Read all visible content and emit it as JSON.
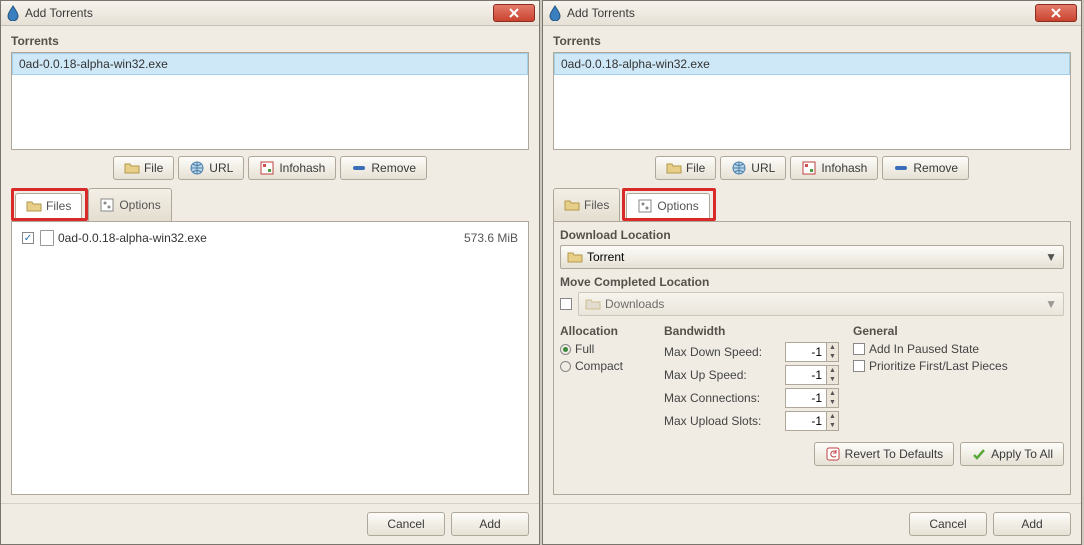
{
  "titlebar": {
    "title": "Add Torrents"
  },
  "torrents": {
    "label": "Torrents",
    "items": [
      "0ad-0.0.18-alpha-win32.exe"
    ]
  },
  "source_buttons": {
    "file": "File",
    "url": "URL",
    "infohash": "Infohash",
    "remove": "Remove"
  },
  "tabs": {
    "files": "Files",
    "options": "Options"
  },
  "files_tab": {
    "name": "0ad-0.0.18-alpha-win32.exe",
    "size": "573.6 MiB"
  },
  "options_tab": {
    "download_location_label": "Download Location",
    "download_location_value": "Torrent",
    "move_completed_label": "Move Completed Location",
    "move_completed_value": "Downloads",
    "allocation": {
      "title": "Allocation",
      "full": "Full",
      "compact": "Compact"
    },
    "bandwidth": {
      "title": "Bandwidth",
      "max_down": "Max Down Speed:",
      "max_up": "Max Up Speed:",
      "max_conn": "Max Connections:",
      "max_slots": "Max Upload Slots:",
      "val_down": "-1",
      "val_up": "-1",
      "val_conn": "-1",
      "val_slots": "-1"
    },
    "general": {
      "title": "General",
      "paused": "Add In Paused State",
      "prioritize": "Prioritize First/Last Pieces"
    },
    "revert": "Revert To Defaults",
    "apply_all": "Apply To All"
  },
  "footer": {
    "cancel": "Cancel",
    "add": "Add"
  }
}
